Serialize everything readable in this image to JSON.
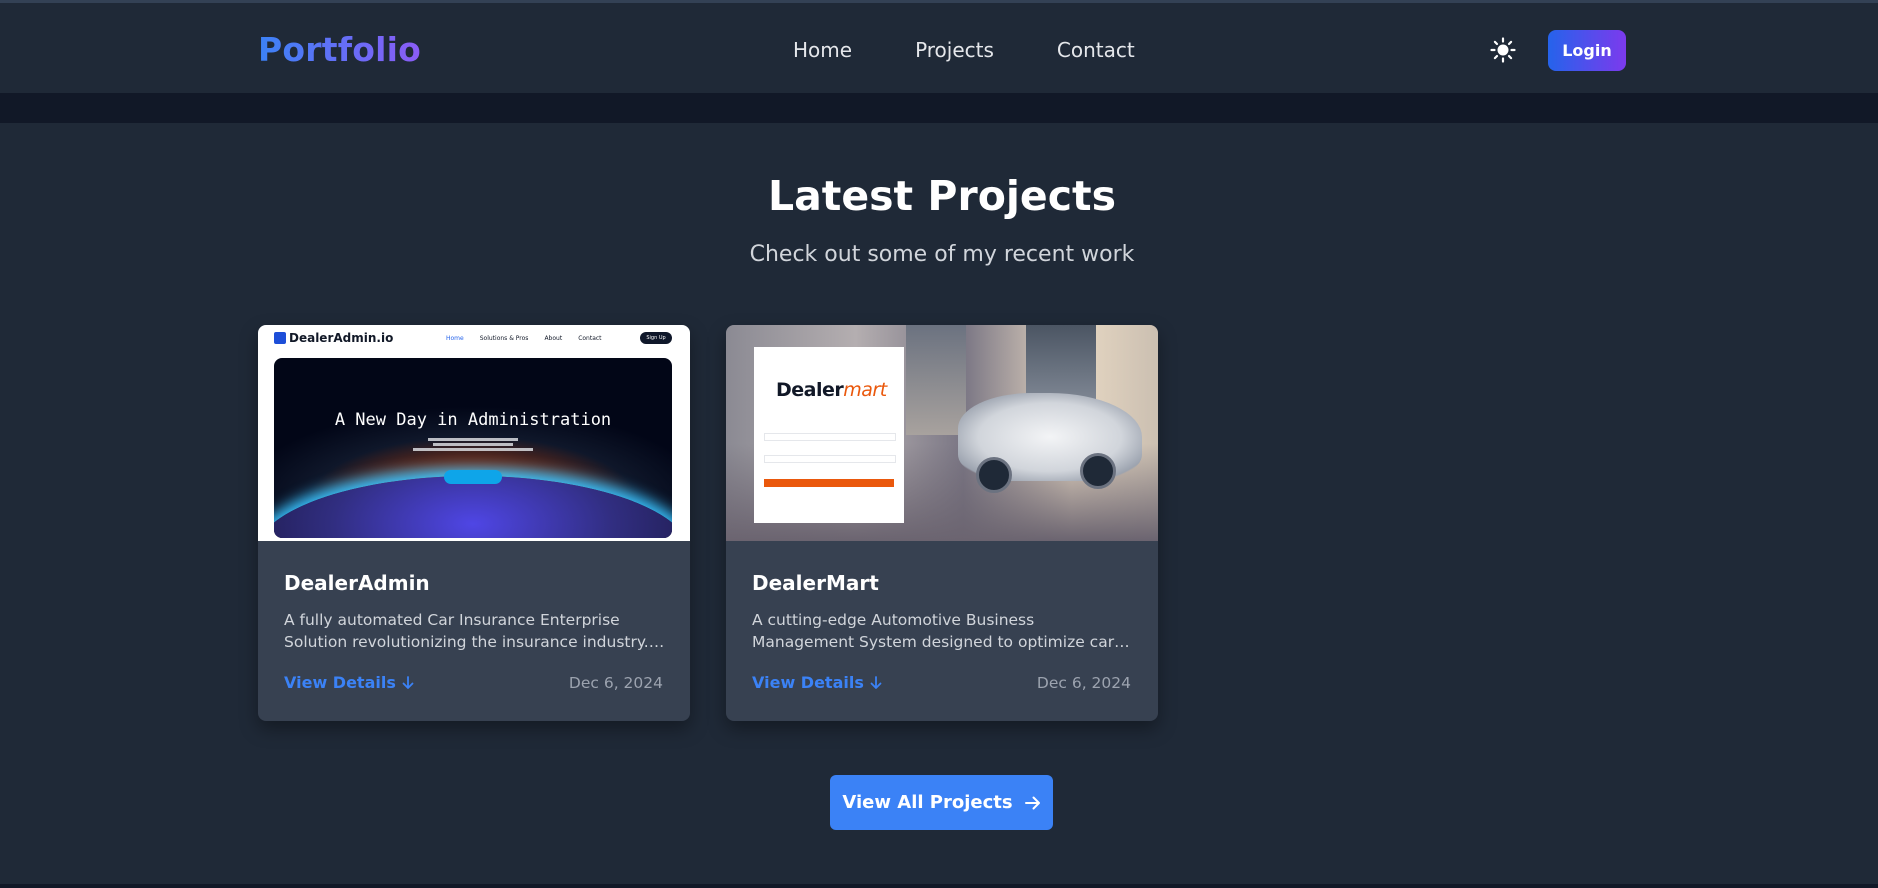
{
  "navbar": {
    "brand": "Portfolio",
    "links": [
      "Home",
      "Projects",
      "Contact"
    ],
    "theme_icon": "sun-icon",
    "login_label": "Login"
  },
  "section": {
    "title": "Latest Projects",
    "subtitle": "Check out some of my recent work"
  },
  "projects": [
    {
      "title": "DealerAdmin",
      "description": "A fully automated Car Insurance Enterprise Solution revolutionizing the insurance industry. Built with...",
      "link_label": "View Details",
      "date": "Dec 6, 2024",
      "thumbnail": {
        "logo": "DealerAdmin.io",
        "nav": [
          "Home",
          "Solutions & Pros",
          "About",
          "Contact"
        ],
        "signup": "Sign Up",
        "headline": "A New Day in Administration"
      }
    },
    {
      "title": "DealerMart",
      "description": "A cutting-edge Automotive Business Management System designed to optimize car leasing, loans, sales...",
      "link_label": "View Details",
      "date": "Dec 6, 2024",
      "thumbnail": {
        "logo_main": "Dealer",
        "logo_accent": "mart"
      }
    }
  ],
  "cta": {
    "label": "View All Projects",
    "icon": "arrow-right-icon"
  },
  "colors": {
    "background": "#1f2937",
    "card": "#374151",
    "accent": "#3b82f6",
    "brand_gradient_start": "#3b82f6",
    "brand_gradient_end": "#8b5cf6"
  }
}
